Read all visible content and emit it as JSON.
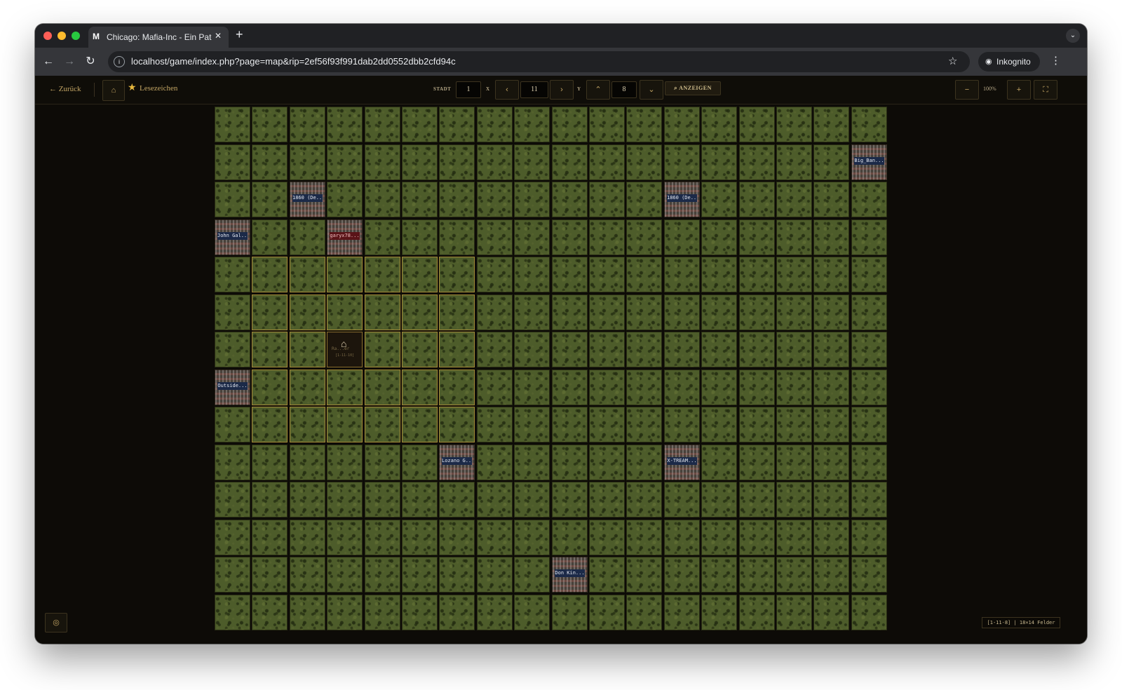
{
  "browser": {
    "tab_favicon": "M",
    "tab_title": "Chicago: Mafia-Inc - Ein Pate",
    "tab_close_icon": "✕",
    "new_tab_icon": "+",
    "tab_search_icon": "⌄",
    "url": "localhost/game/index.php?page=map&rip=2ef56f93f991dab2dd0552dbb2cfd94c",
    "incognito_label": "Inkognito"
  },
  "toolbar": {
    "back_label": "Zurück",
    "bookmarks_label": "Lesezeichen",
    "stadt_label": "STADT",
    "stadt_value": "1",
    "x_label": "X",
    "x_value": "11",
    "y_label": "Y",
    "y_value": "8",
    "show_label": "ANZEIGEN",
    "zoom_value": "100%"
  },
  "map": {
    "columns": 18,
    "rows": 14,
    "player_name": "Ra...er",
    "player_coord": "[1-11-10]",
    "cities": [
      {
        "col": 17,
        "row": 1,
        "label": "Big_Ban..."
      },
      {
        "col": 2,
        "row": 2,
        "label": "1860 (De..."
      },
      {
        "col": 12,
        "row": 2,
        "label": "1860 (De..."
      },
      {
        "col": 0,
        "row": 3,
        "label": "John Gal..."
      },
      {
        "col": 3,
        "row": 3,
        "label": "garyx78...",
        "red": true
      },
      {
        "col": 0,
        "row": 7,
        "label": "Outside..."
      },
      {
        "col": 6,
        "row": 9,
        "label": "Lozano G..."
      },
      {
        "col": 12,
        "row": 9,
        "label": "X-TREAM..."
      },
      {
        "col": 9,
        "row": 12,
        "label": "Don Kin..."
      }
    ]
  },
  "status": "[1-11-8] | 18×14 Felder",
  "colors": {
    "accent": "#c3a564",
    "tile_highlight": "#a38937",
    "background": "#0d0b07"
  }
}
